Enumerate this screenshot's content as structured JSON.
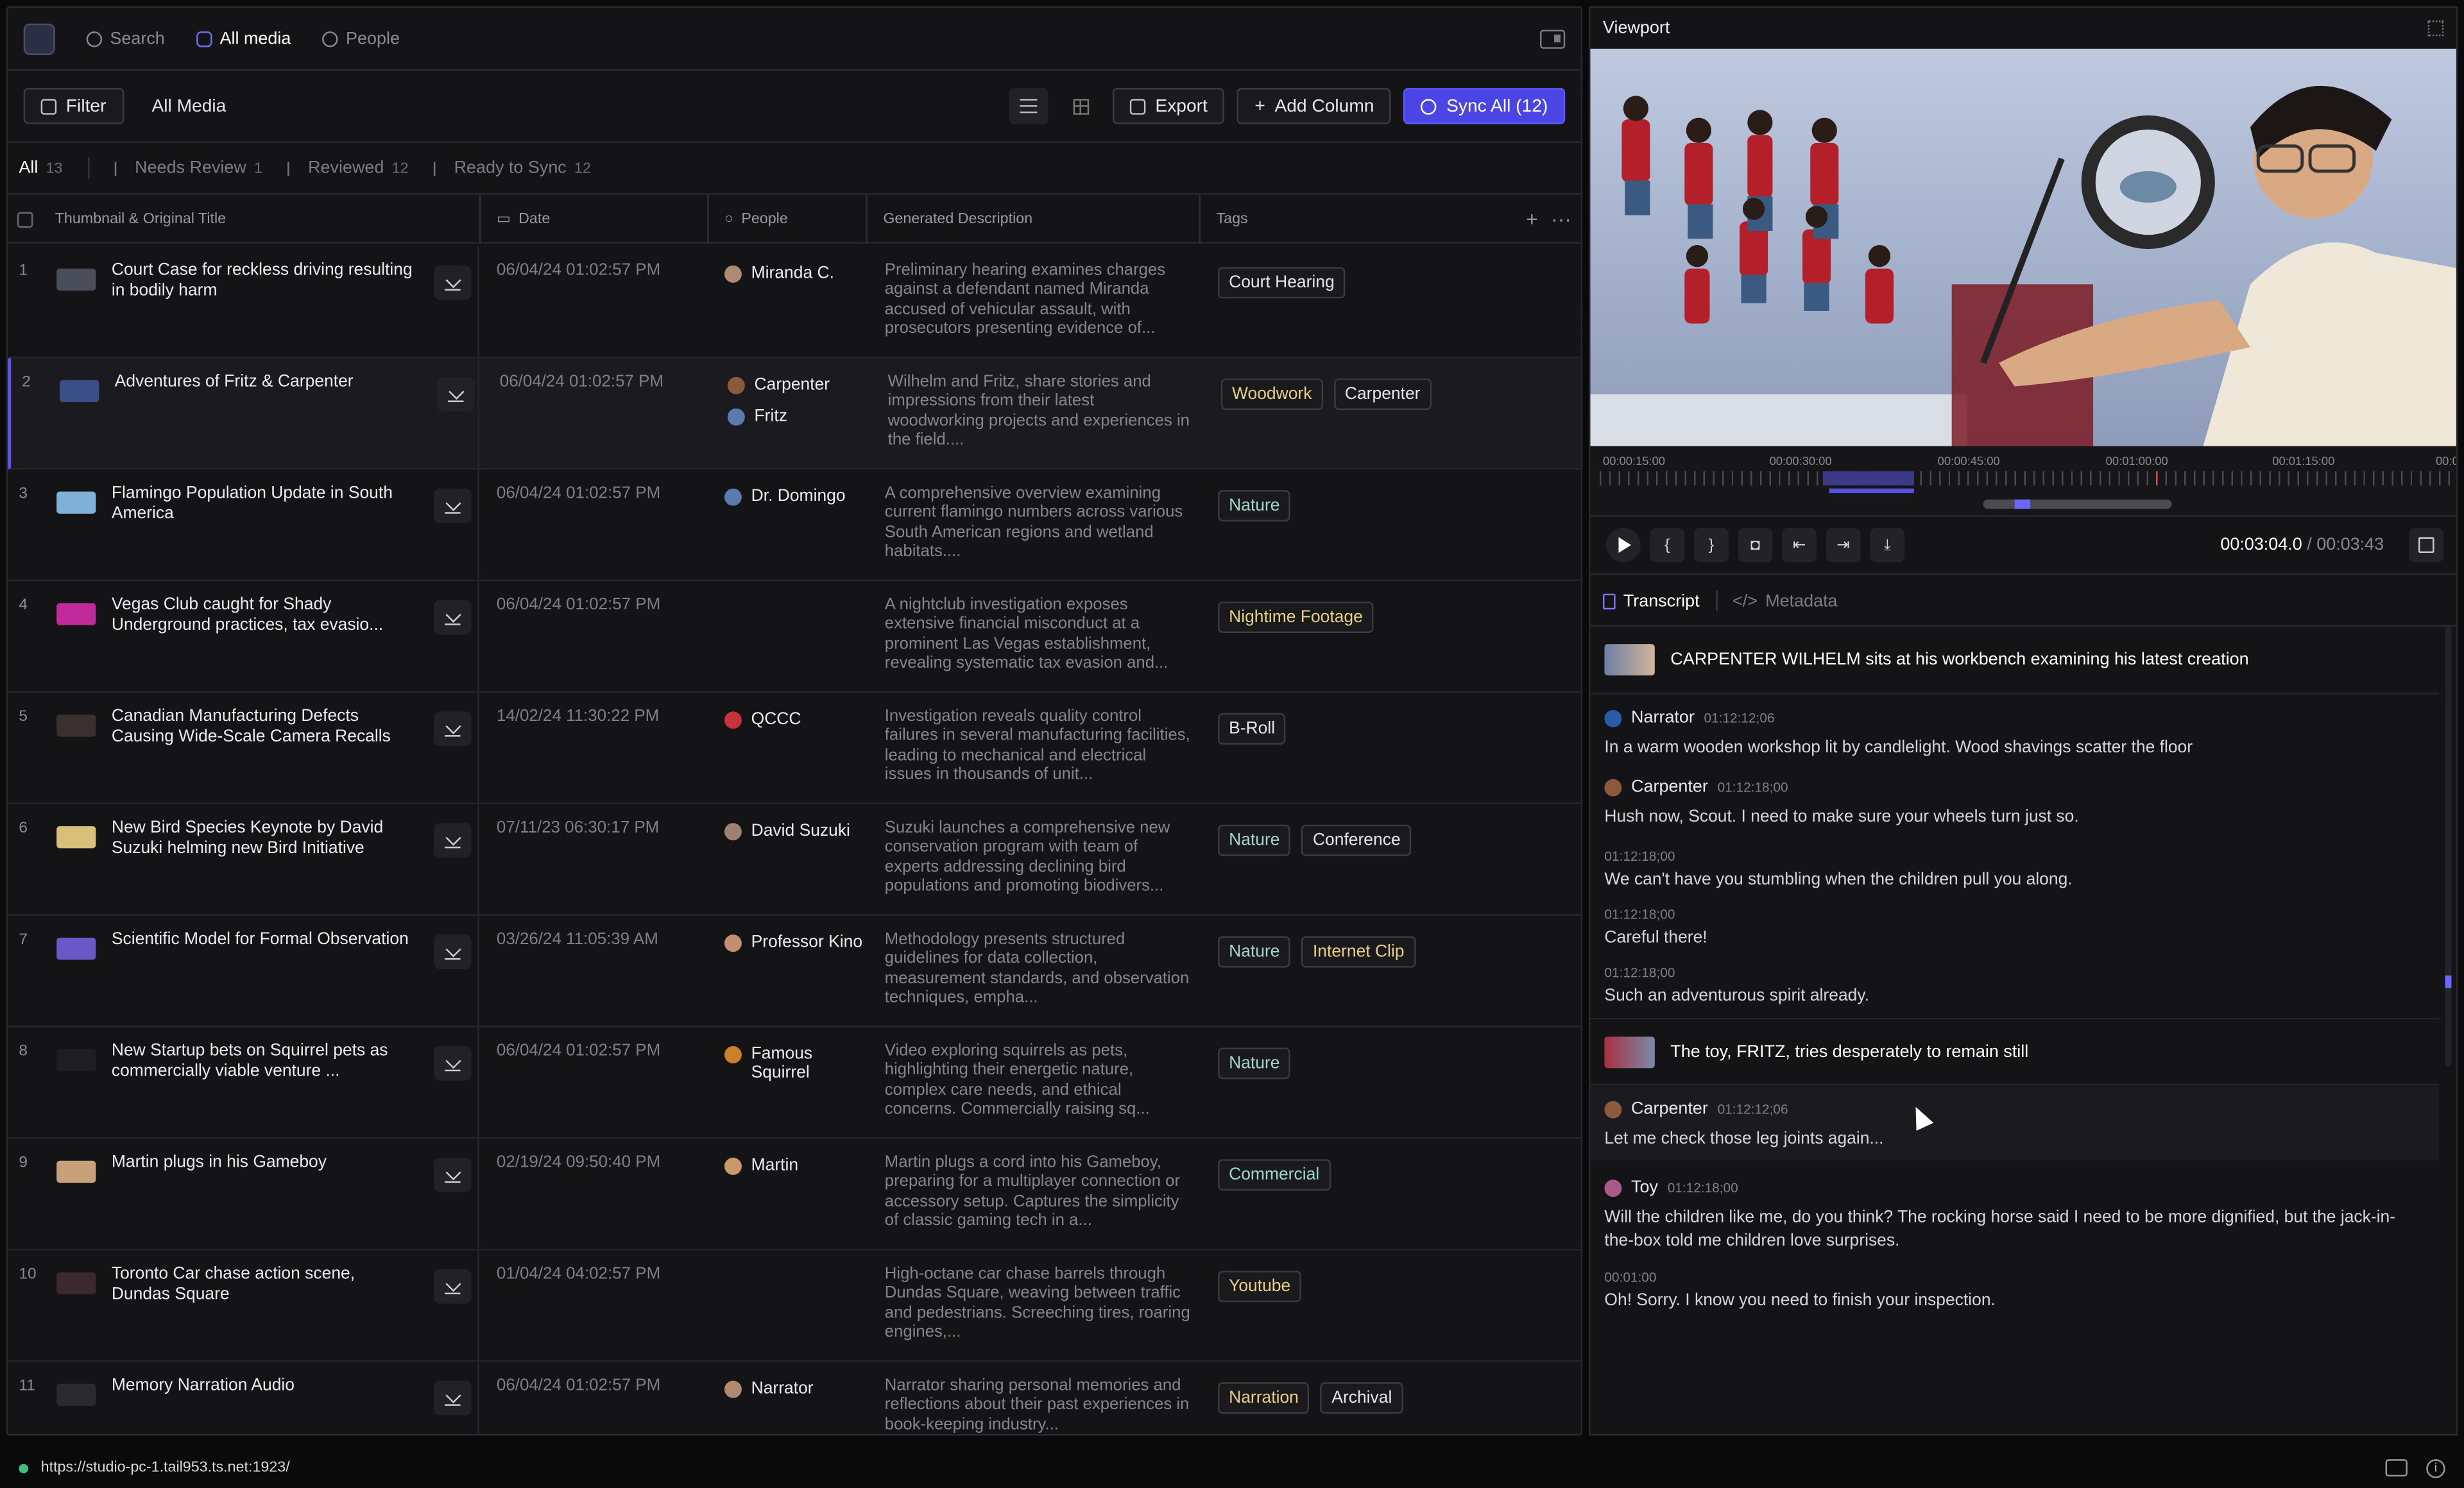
{
  "nav": {
    "search": "Search",
    "all_media": "All media",
    "people": "People"
  },
  "toolbar": {
    "filter": "Filter",
    "crumb": "All Media",
    "export": "Export",
    "add_column": "Add Column",
    "sync_all": "Sync All (12)"
  },
  "filters": [
    {
      "label": "All",
      "count": "13"
    },
    {
      "label": "Needs Review",
      "count": "1"
    },
    {
      "label": "Reviewed",
      "count": "12"
    },
    {
      "label": "Ready to Sync",
      "count": "12"
    }
  ],
  "columns": {
    "thumb_title": "Thumbnail & Original Title",
    "date": "Date",
    "people": "People",
    "description": "Generated Description",
    "tags": "Tags"
  },
  "rows": [
    {
      "num": "1",
      "title": "Court Case for reckless driving resulting in bodily harm",
      "date": "06/04/24 01:02:57 PM",
      "people": [
        "Miranda C."
      ],
      "desc": "Preliminary hearing examines charges against a defendant named Miranda accused of vehicular assault, with prosecutors presenting evidence of...",
      "tags": [
        "Court Hearing"
      ]
    },
    {
      "num": "2",
      "title": "Adventures of Fritz & Carpenter",
      "date": "06/04/24 01:02:57 PM",
      "people": [
        "Carpenter",
        "Fritz"
      ],
      "desc": "Wilhelm and Fritz, share stories and impressions from their latest woodworking projects and experiences in the field....",
      "tags": [
        "Woodwork",
        "Carpenter"
      ]
    },
    {
      "num": "3",
      "title": "Flamingo Population Update in South America",
      "date": "06/04/24 01:02:57 PM",
      "people": [
        "Dr. Domingo"
      ],
      "desc": "A comprehensive overview examining current flamingo numbers across various South American regions and wetland habitats....",
      "tags": [
        "Nature"
      ]
    },
    {
      "num": "4",
      "title": "Vegas Club caught for Shady Underground practices, tax evasio...",
      "date": "06/04/24 01:02:57 PM",
      "people": [],
      "desc": "A nightclub investigation exposes extensive financial misconduct at a prominent Las Vegas establishment, revealing systematic tax evasion and...",
      "tags": [
        "Nightime Footage"
      ]
    },
    {
      "num": "5",
      "title": "Canadian Manufacturing Defects Causing Wide-Scale Camera Recalls",
      "date": "14/02/24 11:30:22 PM",
      "people": [
        "QCCC"
      ],
      "desc": "Investigation reveals quality control failures in several manufacturing facilities, leading to mechanical and electrical issues in thousands of unit...",
      "tags": [
        "B-Roll"
      ]
    },
    {
      "num": "6",
      "title": "New Bird Species Keynote by David Suzuki helming new Bird Initiative",
      "date": "07/11/23 06:30:17 PM",
      "people": [
        "David Suzuki"
      ],
      "desc": "Suzuki launches a comprehensive new conservation program with team of experts addressing declining bird populations and promoting biodivers...",
      "tags": [
        "Nature",
        "Conference"
      ]
    },
    {
      "num": "7",
      "title": "Scientific Model for Formal Observation",
      "date": "03/26/24 11:05:39 AM",
      "people": [
        "Professor Kino"
      ],
      "desc": "Methodology presents structured guidelines for data collection, measurement standards, and observation techniques, empha...",
      "tags": [
        "Nature",
        "Internet Clip"
      ]
    },
    {
      "num": "8",
      "title": "New Startup bets on Squirrel pets as commercially viable venture ...",
      "date": "06/04/24 01:02:57 PM",
      "people": [
        "Famous Squirrel"
      ],
      "desc": "Video exploring squirrels as pets, highlighting their energetic nature, complex care needs, and ethical concerns. Commercially raising sq...",
      "tags": [
        "Nature"
      ]
    },
    {
      "num": "9",
      "title": "Martin plugs in his Gameboy",
      "date": "02/19/24 09:50:40 PM",
      "people": [
        "Martin"
      ],
      "desc": "Martin plugs a cord into his Gameboy, preparing for a multiplayer connection or accessory setup. Captures the simplicity of classic gaming tech in a...",
      "tags": [
        "Commercial"
      ]
    },
    {
      "num": "10",
      "title": "Toronto Car chase action scene, Dundas Square",
      "date": "01/04/24 04:02:57 PM",
      "people": [],
      "desc": "High-octane car chase barrels through Dundas Square, weaving between traffic and pedestrians. Screeching tires, roaring engines,...",
      "tags": [
        "Youtube"
      ]
    },
    {
      "num": "11",
      "title": "Memory Narration Audio",
      "date": "06/04/24 01:02:57 PM",
      "people": [
        "Narrator"
      ],
      "desc": "Narrator sharing personal memories and reflections about their past experiences in book-keeping industry...",
      "tags": [
        "Narration",
        "Archival"
      ]
    }
  ],
  "viewport": {
    "title": "Viewport",
    "timeline_labels": [
      "00:00:15:00",
      "00:00:30:00",
      "00:00:45:00",
      "00:01:00:00",
      "00:01:15:00",
      "00:0"
    ],
    "timecode": "00:03:04.0",
    "timecode_sep": "/",
    "duration": "00:03:43"
  },
  "tabs": {
    "transcript": "Transcript",
    "metadata": "Metadata"
  },
  "transcript": {
    "scene1": "CARPENTER WILHELM sits at his workbench examining his latest creation",
    "e1": {
      "speaker": "Narrator",
      "tc": "01:12:12;06",
      "text": "In a warm wooden workshop lit by candlelight. Wood shavings scatter the floor"
    },
    "e2": {
      "speaker": "Carpenter",
      "tc": "01:12:18;00",
      "text": "Hush now, Scout. I need to make sure your wheels turn just so."
    },
    "e3": {
      "tc": "01:12:18;00",
      "text": "We can't have you stumbling when the children pull you along."
    },
    "e4": {
      "tc": "01:12:18;00",
      "text": "Careful there!"
    },
    "e5": {
      "tc": "01:12:18;00",
      "text": "Such an adventurous spirit already."
    },
    "scene2": "The toy, FRITZ, tries desperately to remain still",
    "e6": {
      "speaker": "Carpenter",
      "tc": "01:12:12;06",
      "text": "Let me check those leg joints again..."
    },
    "e7": {
      "speaker": "Toy",
      "tc": "01:12:18;00",
      "text": "Will the children like me, do you think? The rocking horse said I need to be more dignified, but the jack-in-the-box told me children love surprises."
    },
    "e8": {
      "tc": "00:01:00",
      "text": "Oh! Sorry. I know you need to finish your inspection."
    }
  },
  "status": {
    "url": "https://studio-pc-1.tail953.ts.net:1923/"
  },
  "colors": {
    "accent": "#4b45e6",
    "tag_yellow": "#e7cf86",
    "tag_green": "#9fd8d0"
  }
}
